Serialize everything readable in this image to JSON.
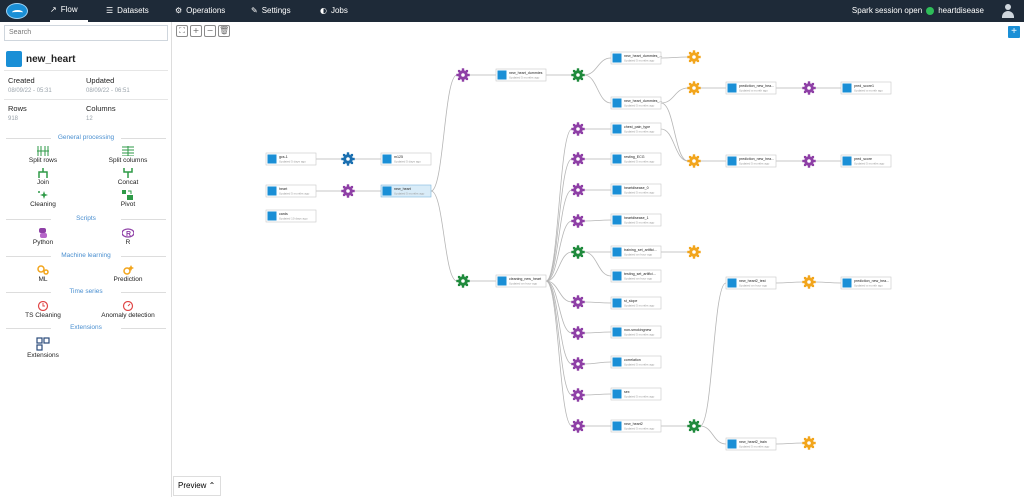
{
  "nav": {
    "tabs": [
      {
        "label": "Flow",
        "icon": "trend-icon"
      },
      {
        "label": "Datasets",
        "icon": "list-icon"
      },
      {
        "label": "Operations",
        "icon": "gear-icon"
      },
      {
        "label": "Settings",
        "icon": "wrench-icon"
      },
      {
        "label": "Jobs",
        "icon": "globe-icon"
      }
    ],
    "session_status": "Spark session open",
    "project": "heartdisease"
  },
  "sidebar": {
    "search_placeholder": "Search",
    "dataset_name": "new_heart",
    "created_label": "Created",
    "created_value": "08/09/22 - 05:31",
    "updated_label": "Updated",
    "updated_value": "08/09/22 - 06:51",
    "rows_label": "Rows",
    "rows_value": "918",
    "columns_label": "Columns",
    "columns_value": "12",
    "sections": {
      "general": "General processing",
      "scripts": "Scripts",
      "ml": "Machine learning",
      "ts": "Time series",
      "ext": "Extensions"
    },
    "tools": {
      "split_rows": "Split rows",
      "split_columns": "Split columns",
      "join": "Join",
      "concat": "Concat",
      "cleaning": "Cleaning",
      "pivot": "Pivot",
      "python": "Python",
      "r": "R",
      "ml": "ML",
      "prediction": "Prediction",
      "ts_cleaning": "TS Cleaning",
      "anomaly": "Anomaly detection",
      "extensions": "Extensions"
    }
  },
  "preview_label": "Preview",
  "colors": {
    "topbar": "#1e2a38",
    "accent": "#1a8fd6",
    "purple_op": "#8e3fa6",
    "green_op": "#1f8a3c",
    "orange_op": "#f2a51c"
  },
  "graph": {
    "datasets": [
      {
        "id": "gcs1",
        "title": "gcs-1",
        "sub": "Updated 5 days ago"
      },
      {
        "id": "heart",
        "title": "heart",
        "sub": "Updated 5 months ago"
      },
      {
        "id": "cards",
        "title": "cards",
        "sub": "Updated 10 days ago"
      },
      {
        "id": "m125",
        "title": "m125",
        "sub": "Updated 5 days ago"
      },
      {
        "id": "newheart",
        "title": "new_heart",
        "sub": "Updated 5 months ago"
      },
      {
        "id": "dummies",
        "title": "new_heart_dummies",
        "sub": "Updated 5 months ago"
      },
      {
        "id": "dummiesA",
        "title": "new_heart_dummies_...",
        "sub": "Updated 5 months ago"
      },
      {
        "id": "dummiesB",
        "title": "new_heart_dummies_...",
        "sub": "Updated 5 months ago"
      },
      {
        "id": "predlog1",
        "title": "prediction_new_hea...",
        "sub": "Updated a month ago"
      },
      {
        "id": "predscore",
        "title": "pred_score1",
        "sub": "Updated a month ago"
      },
      {
        "id": "chestpain",
        "title": "chest_pain_type",
        "sub": "Updated 5 months ago"
      },
      {
        "id": "predlog2",
        "title": "prediction_new_hea...",
        "sub": "Updated 5 months ago"
      },
      {
        "id": "predscore2",
        "title": "pred_score",
        "sub": "Updated 5 months ago"
      },
      {
        "id": "resting",
        "title": "resting_ECG",
        "sub": "Updated 5 months ago"
      },
      {
        "id": "hd0",
        "title": "heartdisease_0",
        "sub": "Updated 5 months ago"
      },
      {
        "id": "hd1",
        "title": "heartdisease_1",
        "sub": "Updated 5 months ago"
      },
      {
        "id": "trainset",
        "title": "training_set_artifici...",
        "sub": "Updated an hour ago"
      },
      {
        "id": "testset",
        "title": "testing_set_artifici...",
        "sub": "Updated an hour ago"
      },
      {
        "id": "cleaning",
        "title": "cleaning_new_heart",
        "sub": "Updated an hour ago"
      },
      {
        "id": "stslope",
        "title": "st_slope",
        "sub": "Updated 5 months ago"
      },
      {
        "id": "nonsmoke",
        "title": "non-smokingnew",
        "sub": "Updated 5 months ago"
      },
      {
        "id": "corr",
        "title": "correlation",
        "sub": "Updated 5 months ago"
      },
      {
        "id": "sex",
        "title": "sex",
        "sub": "Updated 5 months ago"
      },
      {
        "id": "newheart2",
        "title": "new_heart2",
        "sub": "Updated 5 months ago"
      },
      {
        "id": "nh2test",
        "title": "new_heart2_test",
        "sub": "Updated an hour ago"
      },
      {
        "id": "predtest",
        "title": "prediction_new_hea...",
        "sub": "Updated a month ago"
      },
      {
        "id": "nh2train",
        "title": "new_heart2_train",
        "sub": "Updated 5 months ago"
      }
    ]
  }
}
